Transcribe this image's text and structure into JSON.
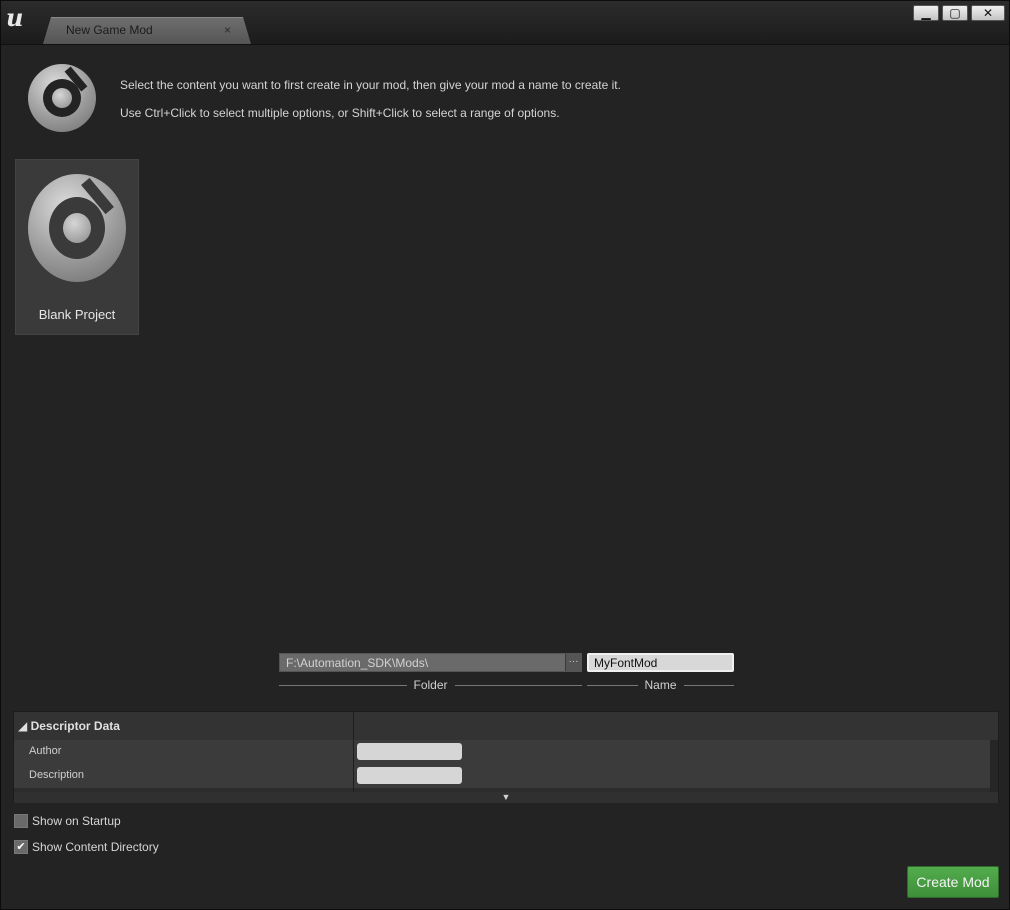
{
  "window": {
    "tab_title": "New Game Mod",
    "tab_close": "×",
    "controls": {
      "minimize": "▁",
      "maximize": "▢",
      "close": "✕"
    }
  },
  "intro": {
    "line1": "Select the content you want to first create in your mod, then give your mod a name to create it.",
    "line2": "Use Ctrl+Click to select multiple options, or Shift+Click to select a range of options."
  },
  "templates": [
    {
      "label": "Blank Project",
      "icon": "blank-project-icon"
    }
  ],
  "location": {
    "folder_value": "F:\\Automation_SDK\\Mods\\",
    "folder_caption": "Folder",
    "browse_label": "···",
    "name_value": "MyFontMod",
    "name_caption": "Name"
  },
  "descriptor": {
    "title": "Descriptor Data",
    "rows": [
      {
        "label": "Author",
        "value": ""
      },
      {
        "label": "Description",
        "value": ""
      }
    ]
  },
  "options": {
    "show_on_startup": {
      "label": "Show on Startup",
      "checked": false
    },
    "show_content_directory": {
      "label": "Show Content Directory",
      "checked": true
    }
  },
  "actions": {
    "create_label": "Create Mod"
  },
  "colors": {
    "accent_green": "#4a9f44",
    "background": "#232323",
    "tile": "#3a3a3a"
  }
}
